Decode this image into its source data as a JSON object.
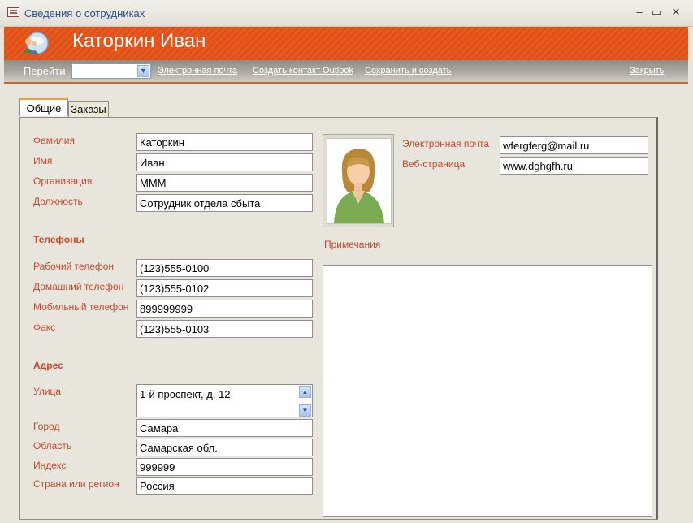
{
  "window": {
    "title": "Сведения о сотрудниках",
    "minimize": "–",
    "maximize": "▭",
    "close": "✕"
  },
  "header": {
    "name": "Каторкин Иван"
  },
  "toolbar": {
    "goto_label": "Перейти",
    "combo_value": "",
    "email_link": "Электронная почта",
    "outlook_link": "Создать контакт Outlook",
    "save_new_link": "Сохранить и создать",
    "close_link": "Закрыть"
  },
  "tabs": [
    {
      "label": "Общие"
    },
    {
      "label": "Заказы"
    }
  ],
  "general": {
    "last_name": {
      "label": "Фамилия",
      "value": "Каторкин"
    },
    "first_name": {
      "label": "Имя",
      "value": "Иван"
    },
    "company": {
      "label": "Организация",
      "value": "МММ"
    },
    "job_title": {
      "label": "Должность",
      "value": "Сотрудник отдела сбыта"
    },
    "email": {
      "label": "Электронная почта",
      "value": "wfergferg@mail.ru"
    },
    "web": {
      "label": "Веб-страница",
      "value": "www.dghgfh.ru"
    }
  },
  "phones": {
    "title": "Телефоны",
    "business": {
      "label": "Рабочий телефон",
      "value": "(123)555-0100"
    },
    "home": {
      "label": "Домашний телефон",
      "value": "(123)555-0102"
    },
    "mobile": {
      "label": "Мобильный телефон",
      "value": "899999999"
    },
    "fax": {
      "label": "Факс",
      "value": "(123)555-0103"
    }
  },
  "address": {
    "title": "Адрес",
    "street": {
      "label": "Улица",
      "value": "1-й проспект, д. 12"
    },
    "city": {
      "label": "Город",
      "value": "Самара"
    },
    "region": {
      "label": "Область",
      "value": "Самарская обл."
    },
    "zip": {
      "label": "Индекс",
      "value": "999999"
    },
    "country": {
      "label": "Страна или регион",
      "value": "Россия"
    }
  },
  "notes": {
    "label": "Примечания",
    "value": ""
  },
  "colors": {
    "accent": "#e8591e",
    "label": "#c44a2e",
    "link_title": "#2a4e8f"
  }
}
